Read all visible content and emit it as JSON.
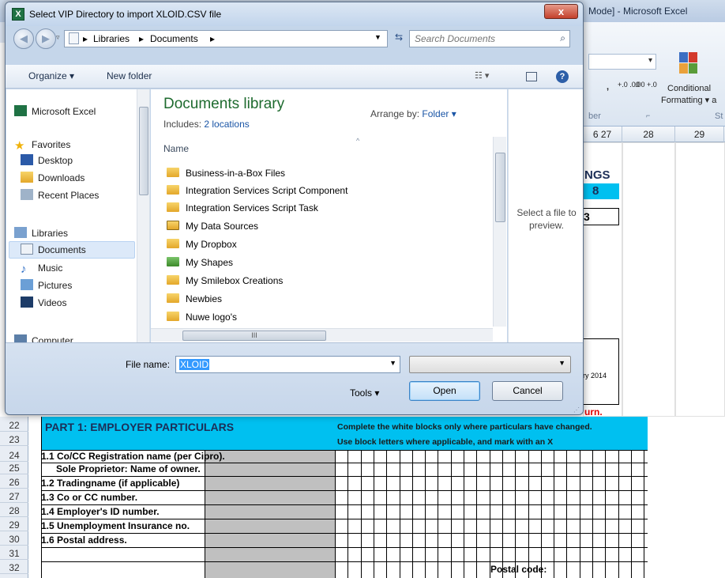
{
  "excel": {
    "title": "Mode] - Microsoft Excel",
    "ribbon": {
      "comma": ",",
      "decimal_increase": "+.0 .00",
      "decimal_decrease": ".00 +.0",
      "conditional_line1": "Conditional",
      "conditional_line2": "Formatting ▾ a",
      "number_group": "ber",
      "styles_group": "St"
    },
    "columns": [
      "6 27",
      "28",
      "29"
    ],
    "fragments": {
      "ngs": "NGS",
      "eight": "8",
      "three": "3",
      "date": "ry 2014",
      "return": "urn."
    },
    "rows": [
      "22",
      "23",
      "24",
      "25",
      "26",
      "27",
      "28",
      "29",
      "30",
      "31",
      "32"
    ],
    "part_title": "PART 1: EMPLOYER PARTICULARS",
    "note1": "Complete the white blocks only where particulars have changed.",
    "note2": "Use block letters where applicable, and mark with an X",
    "labels": [
      "1.1 Co/CC Registration name (per Cipro).",
      "Sole Proprietor: Name of owner.",
      "1.2 Tradingname (if applicable)",
      "1.3 Co or CC number.",
      "1.4 Employer's ID number.",
      "1.5 Unemployment Insurance no.",
      "1.6 Postal address."
    ],
    "postal_code": "Postal code:"
  },
  "dialog": {
    "title": "Select VIP Directory to import XLOID.CSV file",
    "close": "x",
    "breadcrumb": [
      "Libraries",
      "Documents"
    ],
    "search_placeholder": "Search Documents",
    "toolbar": {
      "organize": "Organize ▾",
      "new_folder": "New folder"
    },
    "nav": {
      "microsoft_excel": "Microsoft Excel",
      "favorites": "Favorites",
      "desktop": "Desktop",
      "downloads": "Downloads",
      "recent_places": "Recent Places",
      "libraries": "Libraries",
      "documents": "Documents",
      "music": "Music",
      "pictures": "Pictures",
      "videos": "Videos",
      "computer": "Computer"
    },
    "library_title": "Documents library",
    "includes_label": "Includes:",
    "includes_link": "2 locations",
    "arrange_label": "Arrange by:",
    "arrange_value": "Folder ▾",
    "column_name": "Name",
    "files": [
      "Business-in-a-Box Files",
      "Integration Services Script Component",
      "Integration Services Script Task",
      "My Data Sources",
      "My Dropbox",
      "My Shapes",
      "My Smilebox Creations",
      "Newbies",
      "Nuwe logo's"
    ],
    "preview_text": "Select a file to preview.",
    "file_name_label": "File name:",
    "file_name_value": "XLOID",
    "tools_label": "Tools ▾",
    "open_label": "Open",
    "cancel_label": "Cancel"
  }
}
